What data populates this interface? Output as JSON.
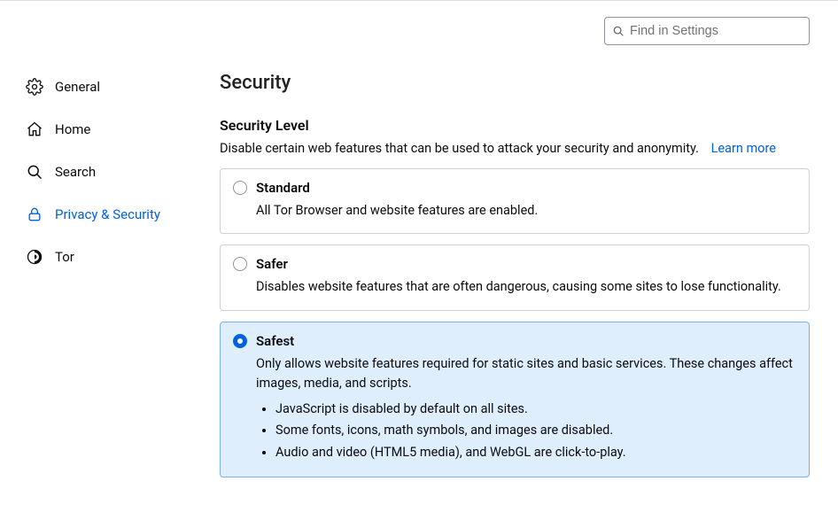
{
  "search": {
    "placeholder": "Find in Settings"
  },
  "sidebar": {
    "items": [
      {
        "label": "General"
      },
      {
        "label": "Home"
      },
      {
        "label": "Search"
      },
      {
        "label": "Privacy & Security"
      },
      {
        "label": "Tor"
      }
    ]
  },
  "main": {
    "title": "Security",
    "section_title": "Security Level",
    "section_desc": "Disable certain web features that can be used to attack your security and anonymity.",
    "learn_more": "Learn more",
    "options": [
      {
        "name": "Standard",
        "desc": "All Tor Browser and website features are enabled."
      },
      {
        "name": "Safer",
        "desc": "Disables website features that are often dangerous, causing some sites to lose functionality."
      },
      {
        "name": "Safest",
        "desc": "Only allows website features required for static sites and basic services. These changes affect images, media, and scripts.",
        "bullets": [
          "JavaScript is disabled by default on all sites.",
          "Some fonts, icons, math symbols, and images are disabled.",
          "Audio and video (HTML5 media), and WebGL are click-to-play."
        ]
      }
    ]
  }
}
